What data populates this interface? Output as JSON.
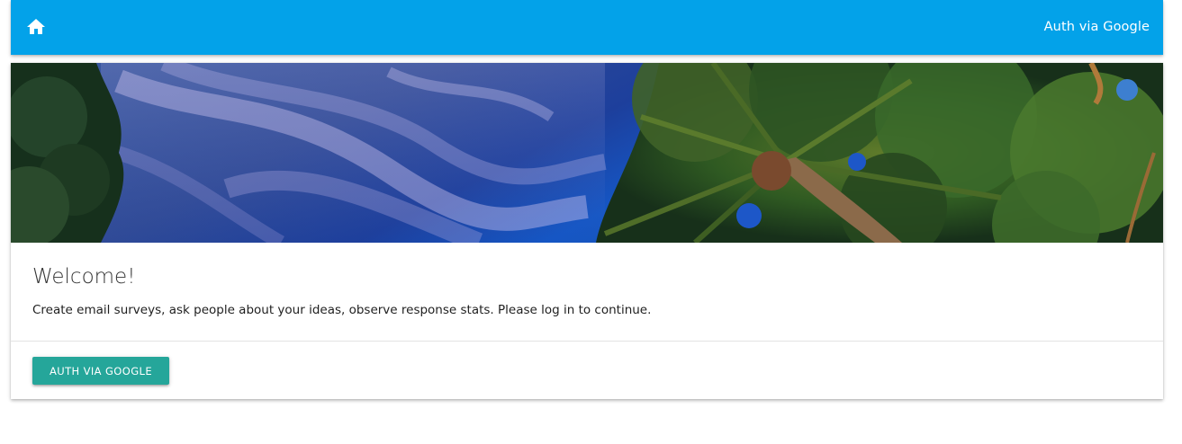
{
  "navbar": {
    "home_icon": "home-icon",
    "auth_link_label": "Auth via Google",
    "color": "#03a2e9"
  },
  "card": {
    "image": "night sky with palm trees",
    "title": "Welcome!",
    "text": "Create email surveys, ask people about your ideas, observe response stats. Please log in to continue.",
    "action_button_label": "Auth via Google",
    "button_color": "#25a69a"
  }
}
